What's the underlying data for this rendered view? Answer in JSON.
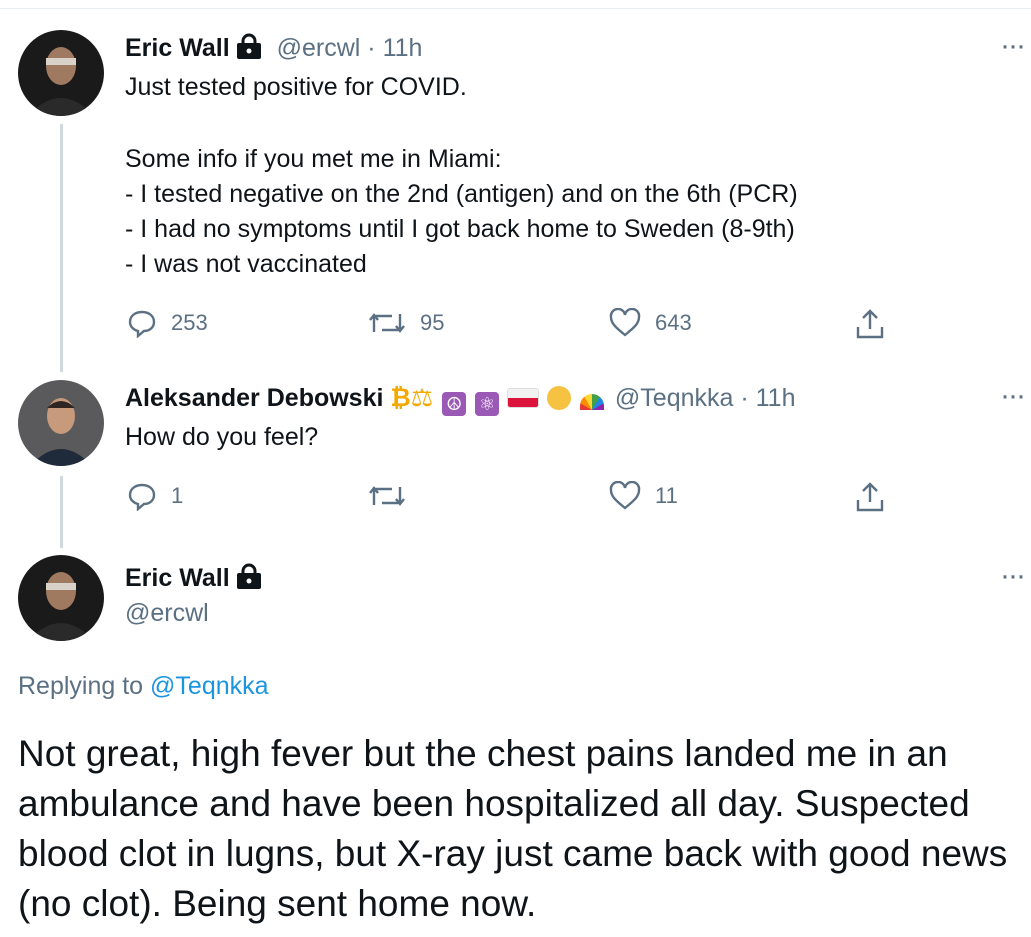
{
  "tweet1": {
    "name": "Eric Wall",
    "handle": "@ercwl",
    "time": "· 11h",
    "line1": "Just tested positive for COVID.",
    "line2": "Some info if you met me in Miami:\n- I tested negative on the 2nd (antigen) and on the 6th (PCR)\n- I had no symptoms until I got back home to Sweden (8-9th)\n- I was not vaccinated",
    "replies": "253",
    "retweets": "95",
    "likes": "643"
  },
  "tweet2": {
    "name": "Aleksander Debowski",
    "name_suffix": "₿⚖",
    "handle": "@Teqnkka",
    "time": "· 11h",
    "text": "How do you feel?",
    "replies": "1",
    "retweets": "",
    "likes": "11"
  },
  "tweet3": {
    "name": "Eric Wall",
    "handle": "@ercwl",
    "replying_label": "Replying to",
    "replying_handle": "@Teqnkka",
    "text": "Not great, high fever but the chest pains landed me in an ambulance and have been hospitalized all day. Suspected blood clot in lugns, but X-ray just came back with good news (no clot). Being sent home now."
  },
  "icons": {
    "more": "more-horizontal-icon",
    "reply": "reply-icon",
    "retweet": "retweet-icon",
    "like": "heart-icon",
    "share": "share-icon",
    "lock": "lock-icon"
  },
  "colors": {
    "text": "#0f1419",
    "muted": "#5b7083",
    "link": "#1b95e0",
    "thread": "#cfd9de"
  }
}
